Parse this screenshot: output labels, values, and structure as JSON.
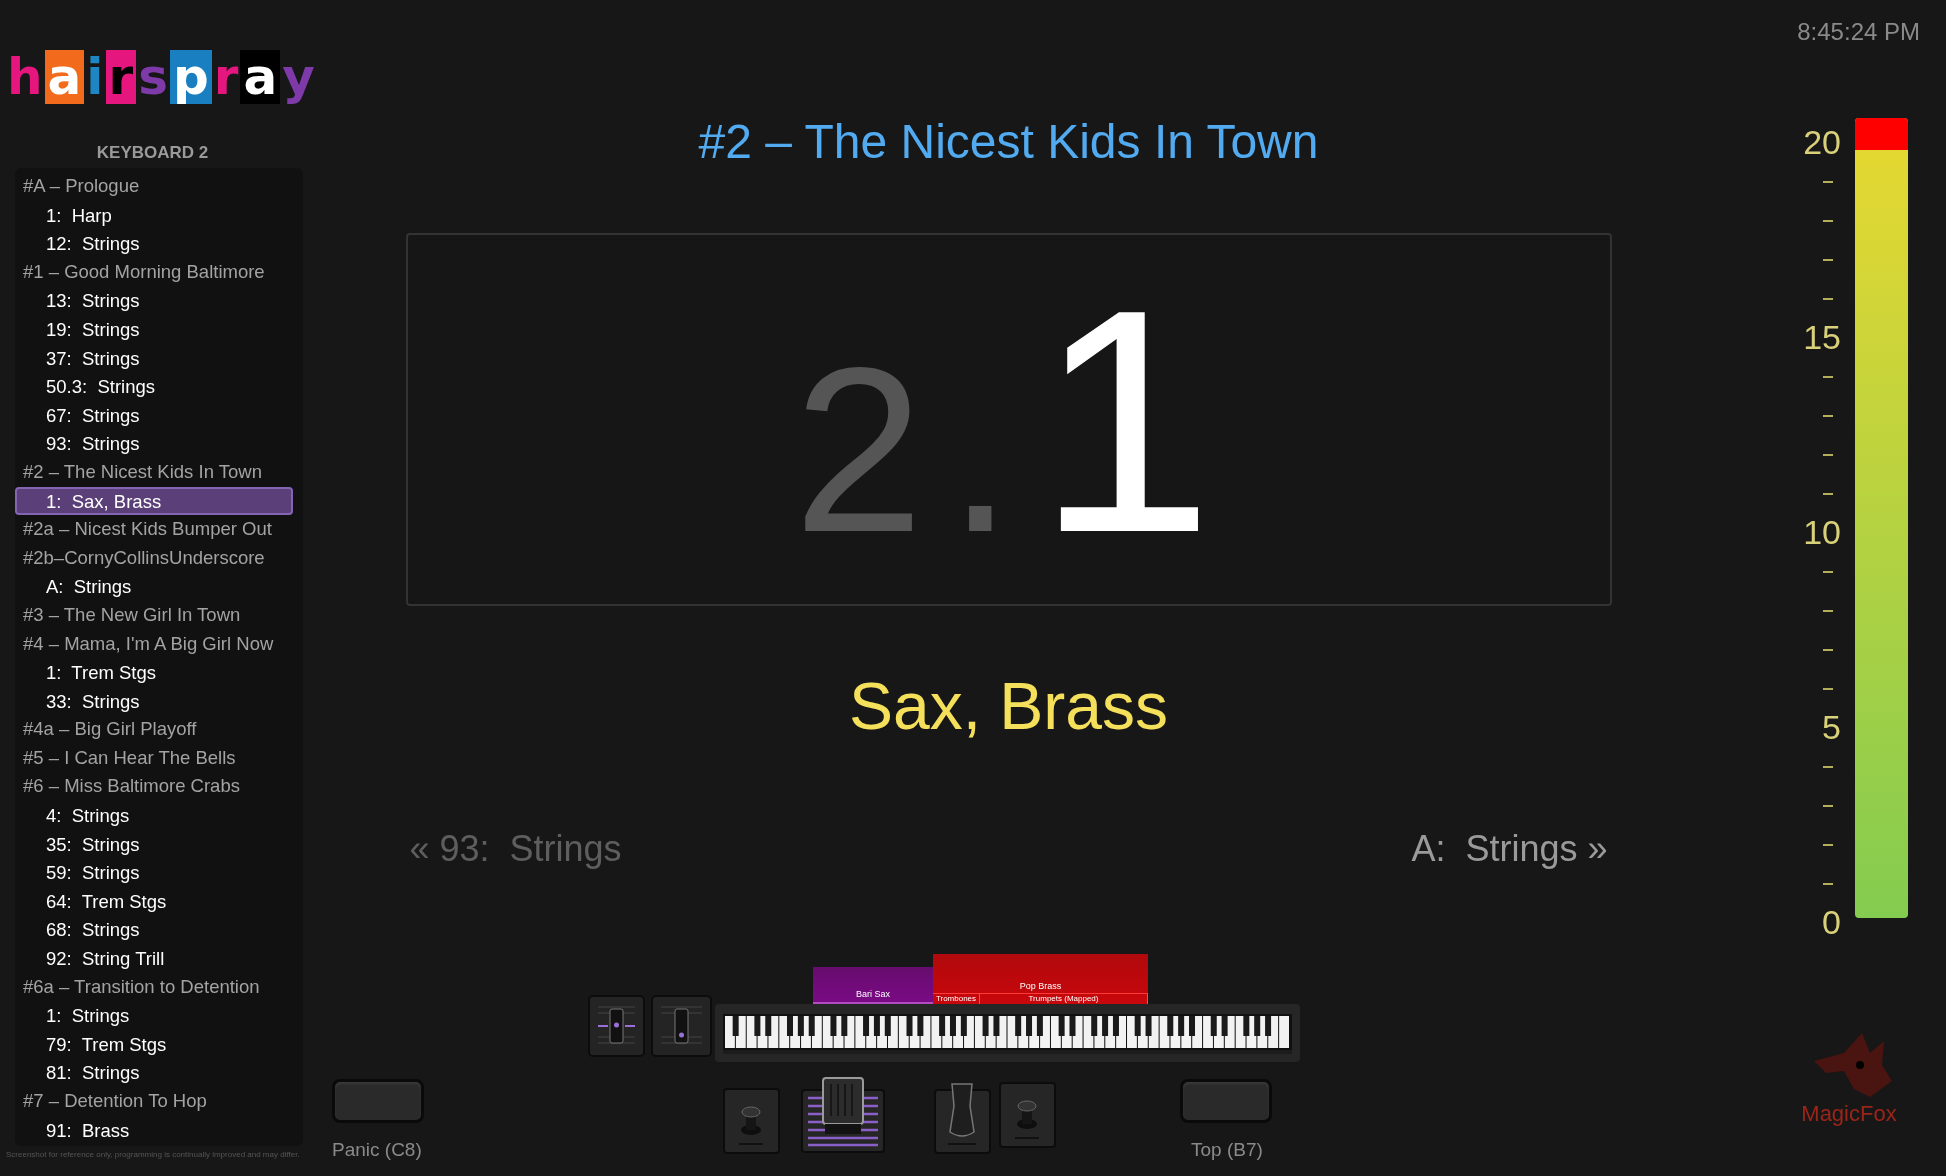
{
  "clock": "8:45:24 PM",
  "logo": {
    "letters": [
      {
        "char": "h",
        "kind": "plain",
        "color": "#e6167f"
      },
      {
        "char": "a",
        "kind": "reversed",
        "color": "#f26a1b"
      },
      {
        "char": "i",
        "kind": "plain",
        "color": "#1f86c4"
      },
      {
        "char": "r",
        "kind": "inked",
        "color": "#e6167f"
      },
      {
        "char": "s",
        "kind": "plain",
        "color": "#7d3aa8"
      },
      {
        "char": "p",
        "kind": "reversed",
        "color": "#1a7fc0"
      },
      {
        "char": "r",
        "kind": "plain",
        "color": "#e6167f"
      },
      {
        "char": "a",
        "kind": "reversed",
        "color": "#000000"
      },
      {
        "char": "y",
        "kind": "plain",
        "color": "#7d3aa8"
      }
    ]
  },
  "sidebar": {
    "heading": "KEYBOARD 2",
    "songs": [
      {
        "title": "#A – Prologue",
        "children": [
          {
            "label": "1:  Harp",
            "selected": false
          },
          {
            "label": "12:  Strings",
            "selected": false
          }
        ]
      },
      {
        "title": "#1 – Good Morning Baltimore",
        "children": [
          {
            "label": "13:  Strings",
            "selected": false
          },
          {
            "label": "19:  Strings",
            "selected": false
          },
          {
            "label": "37:  Strings",
            "selected": false
          },
          {
            "label": "50.3:  Strings",
            "selected": false
          },
          {
            "label": "67:  Strings",
            "selected": false
          },
          {
            "label": "93:  Strings",
            "selected": false
          }
        ]
      },
      {
        "title": "#2 – The Nicest Kids In Town",
        "children": [
          {
            "label": "1:  Sax, Brass",
            "selected": true
          }
        ]
      },
      {
        "title": "#2a – Nicest Kids Bumper Out"
      },
      {
        "title": "#2b–CornyCollinsUnderscore",
        "children": [
          {
            "label": "A:  Strings",
            "selected": false
          }
        ]
      },
      {
        "title": "#3 – The New Girl In Town"
      },
      {
        "title": "#4 – Mama, I'm A Big Girl Now",
        "children": [
          {
            "label": "1:  Trem Stgs",
            "selected": false
          },
          {
            "label": "33:  Strings",
            "selected": false
          }
        ]
      },
      {
        "title": "#4a – Big Girl Playoff"
      },
      {
        "title": "#5 – I Can Hear The Bells"
      },
      {
        "title": "#6 – Miss Baltimore Crabs",
        "children": [
          {
            "label": "4:  Strings",
            "selected": false
          },
          {
            "label": "35:  Strings",
            "selected": false
          },
          {
            "label": "59:  Strings",
            "selected": false
          },
          {
            "label": "64:  Trem Stgs",
            "selected": false
          },
          {
            "label": "68:  Strings",
            "selected": false
          },
          {
            "label": "92:  String Trill",
            "selected": false
          }
        ]
      },
      {
        "title": "#6a – Transition to Detention",
        "children": [
          {
            "label": "1:  Strings",
            "selected": false
          },
          {
            "label": "79:  Trem Stgs",
            "selected": false
          },
          {
            "label": "81:  Strings",
            "selected": false
          }
        ]
      },
      {
        "title": "#7 – Detention To Hop",
        "children": [
          {
            "label": "91:  Brass",
            "selected": false
          }
        ]
      }
    ],
    "footnote": "Screenshot for reference only, programming is continually improved and may differ."
  },
  "song_title": "#2 – The Nicest Kids In Town",
  "patch_number": {
    "song": "2",
    "separator": ".",
    "patch": "1"
  },
  "patch_name": "Sax, Brass",
  "previous": {
    "arrow": "«",
    "label": "93:  Strings"
  },
  "next": {
    "label": "A:  Strings",
    "arrow": "»"
  },
  "zones": [
    {
      "kind": "single",
      "label": "Bari Sax",
      "color": "#7a0a84"
    },
    {
      "kind": "group",
      "label": "Pop Brass",
      "color": "#c8070b",
      "parts": [
        "Trombones",
        "Trumpets (Mapped)"
      ]
    }
  ],
  "panic_label": "Panic (C8)",
  "top_label": "Top (B7)",
  "meter": {
    "labels": [
      "20",
      "15",
      "10",
      "5",
      "0"
    ],
    "level": 1,
    "clip": true
  },
  "brand": "MagicFox"
}
